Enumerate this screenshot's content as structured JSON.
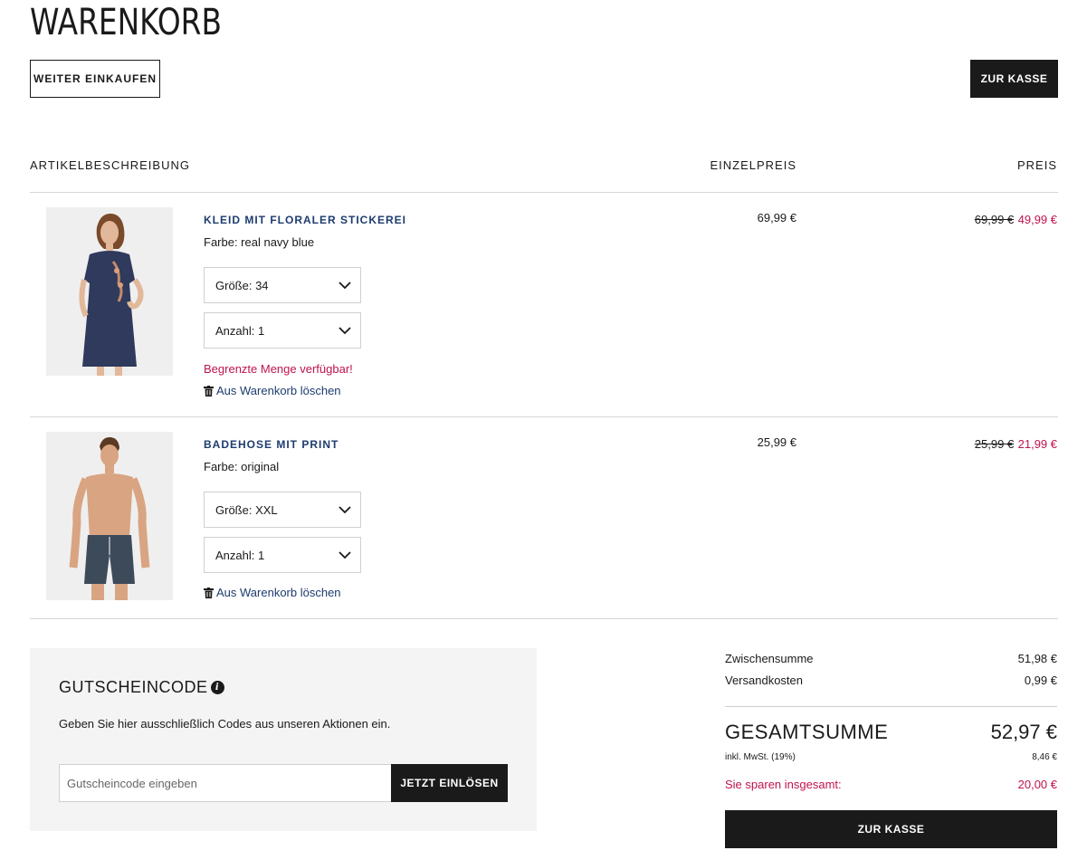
{
  "page": {
    "title": "WARENKORB"
  },
  "actions": {
    "continue_shopping": "WEITER EINKAUFEN",
    "checkout": "ZUR KASSE"
  },
  "table": {
    "headers": {
      "description": "ARTIKELBESCHREIBUNG",
      "unit_price": "EINZELPREIS",
      "price": "PREIS"
    }
  },
  "items": [
    {
      "name": "KLEID MIT FLORALER STICKEREI",
      "color": "Farbe: real navy blue",
      "size": "Größe: 34",
      "quantity": "Anzahl: 1",
      "stock_note": "Begrenzte Menge verfügbar!",
      "delete": "Aus Warenkorb löschen",
      "unit_price": "69,99 €",
      "old_price": "69,99 €",
      "new_price": "49,99 €"
    },
    {
      "name": "BADEHOSE MIT PRINT",
      "color": "Farbe: original",
      "size": "Größe: XXL",
      "quantity": "Anzahl: 1",
      "delete": "Aus Warenkorb löschen",
      "unit_price": "25,99 €",
      "old_price": "25,99 €",
      "new_price": "21,99 €"
    }
  ],
  "coupon": {
    "title": "GUTSCHEINCODE",
    "info": "i",
    "description": "Geben Sie hier ausschließlich Codes aus unseren Aktionen ein.",
    "placeholder": "Gutscheincode eingeben",
    "redeem": "JETZT EINLÖSEN"
  },
  "summary": {
    "subtotal_label": "Zwischensumme",
    "subtotal": "51,98 €",
    "shipping_label": "Versandkosten",
    "shipping": "0,99 €",
    "total_label": "GESAMTSUMME",
    "total": "52,97 €",
    "vat_label": "inkl. MwSt. (19%)",
    "vat": "8,46 €",
    "savings_label": "Sie sparen insgesamt:",
    "savings": "20,00 €",
    "checkout": "ZUR KASSE"
  },
  "colors": {
    "accent": "#c0124f",
    "link": "#1d3c6e",
    "dark": "#1a1a1a",
    "panel": "#f4f4f4"
  }
}
